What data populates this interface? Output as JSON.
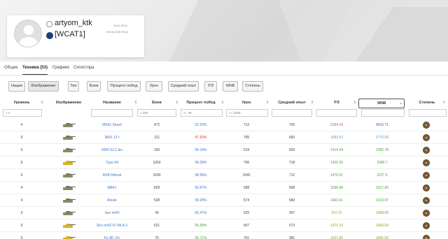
{
  "profile": {
    "nickname": "artyom_ktk",
    "clan": "[WCAT1]",
    "date_registered": "16.11.2013",
    "date_last_battle": "29.08.2020 09:24"
  },
  "tabs": [
    {
      "label": "Общее"
    },
    {
      "label": "Техника (53)"
    },
    {
      "label": "Графики"
    },
    {
      "label": "Ситистора"
    }
  ],
  "filters": [
    {
      "label": "Нация"
    },
    {
      "label": "Изображение"
    },
    {
      "label": "Тип"
    },
    {
      "label": "Боев"
    },
    {
      "label": "Процент побед"
    },
    {
      "label": "Урон"
    },
    {
      "label": "Средний опыт"
    },
    {
      "label": "РЭ"
    },
    {
      "label": "WN8"
    },
    {
      "label": "Степень"
    }
  ],
  "columns": {
    "level": "Уровень",
    "image": "Изображение",
    "name": "Название",
    "battles": "Боев",
    "winrate": "Процент побед",
    "damage": "Урон",
    "avg_exp": "Средний опыт",
    "re": "РЭ",
    "wn8": "WN8",
    "mastery": "Степень"
  },
  "filter_inputs": {
    "level": "> 4",
    "battles": "> 200",
    "winrate": ">= 49",
    "damage": ">= 1000"
  },
  "colors": {
    "blue": "#3b7bc8",
    "red": "#e0342c",
    "green": "#48a23a",
    "olive": "#8a9b1e",
    "purple": "#8a3ab8",
    "lightblue": "#4aa0d8",
    "orange": "#d8a020",
    "magenta": "#c33ab8"
  },
  "rows": [
    {
      "level": "4",
      "name": "M5A1 Stuart",
      "battles": "472",
      "winrate": "52.93%",
      "winrate_color": "#3b7bc8",
      "damage": "712",
      "avg_exp": "720",
      "re": "2154.16",
      "re_color": "#c33ab8",
      "wn8": "4016.71",
      "wn8_color": "#8a3ab8",
      "gold": false
    },
    {
      "level": "6",
      "name": "AMX 12 t",
      "battles": "121",
      "winrate": "47.93%",
      "winrate_color": "#e0342c",
      "damage": "785",
      "avg_exp": "656",
      "re": "1593.63",
      "re_color": "#4aa0d8",
      "wn8": "2776.92",
      "wn8_color": "#4aa0d8",
      "gold": false
    },
    {
      "level": "5",
      "name": "AMX ELC bis",
      "battles": "156",
      "winrate": "50.18%",
      "winrate_color": "#3b7bc8",
      "damage": "519",
      "avg_exp": "626",
      "re": "1414.34",
      "re_color": "#48a23a",
      "wn8": "2282.78",
      "wn8_color": "#48a23a",
      "gold": false
    },
    {
      "level": "6",
      "name": "Type 64",
      "battles": "1050",
      "winrate": "58.38%",
      "winrate_color": "#3b7bc8",
      "damage": "796",
      "avg_exp": "718",
      "re": "1420.25",
      "re_color": "#48a23a",
      "wn8": "2380.7",
      "wn8_color": "#48a23a",
      "gold": true
    },
    {
      "level": "6",
      "name": "M18 Hellcat",
      "battles": "1690",
      "winrate": "58.58%",
      "winrate_color": "#3b7bc8",
      "damage": "1045",
      "avg_exp": "712",
      "re": "1476.01",
      "re_color": "#48a23a",
      "wn8": "2227.5",
      "wn8_color": "#48a23a",
      "gold": false
    },
    {
      "level": "4",
      "name": "M8A1",
      "battles": "828",
      "winrate": "60.87%",
      "winrate_color": "#3b7bc8",
      "damage": "588",
      "avg_exp": "598",
      "re": "1536.68",
      "re_color": "#48a23a",
      "wn8": "2217.83",
      "wn8_color": "#48a23a",
      "gold": false
    },
    {
      "level": "4",
      "name": "Aleste",
      "battles": "528",
      "winrate": "59.28%",
      "winrate_color": "#3b7bc8",
      "damage": "574",
      "avg_exp": "580",
      "re": "1463.41",
      "re_color": "#48a23a",
      "wn8": "2133.97",
      "wn8_color": "#48a23a",
      "gold": false
    },
    {
      "level": "5",
      "name": "Sav m/43",
      "battles": "43",
      "semantic": "",
      "winrate": "60.47%",
      "winrate_color": "#3b7bc8",
      "damage": "525",
      "avg_exp": "397",
      "re": "892.05",
      "re_color": "#d8a020",
      "wn8": "1968.89",
      "wn8_color": "#8a9b1e",
      "gold": false
    },
    {
      "level": "6",
      "name": "Strv m/42-57 Alt A.2",
      "battles": "621",
      "winrate": "56.68%",
      "winrate_color": "#48a23a",
      "damage": "957",
      "avg_exp": "673",
      "re": "1371.13",
      "re_color": "#8a9b1e",
      "wn8": "1942.63",
      "wn8_color": "#8a9b1e",
      "gold": true
    },
    {
      "level": "5",
      "name": "Pz.Sfl. IVc",
      "battles": "70",
      "winrate": "55.71%",
      "winrate_color": "#48a23a",
      "damage": "701",
      "avg_exp": "381",
      "re": "1227.66",
      "re_color": "#8a9b1e",
      "wn8": "1941.52",
      "wn8_color": "#8a9b1e",
      "gold": true
    }
  ]
}
